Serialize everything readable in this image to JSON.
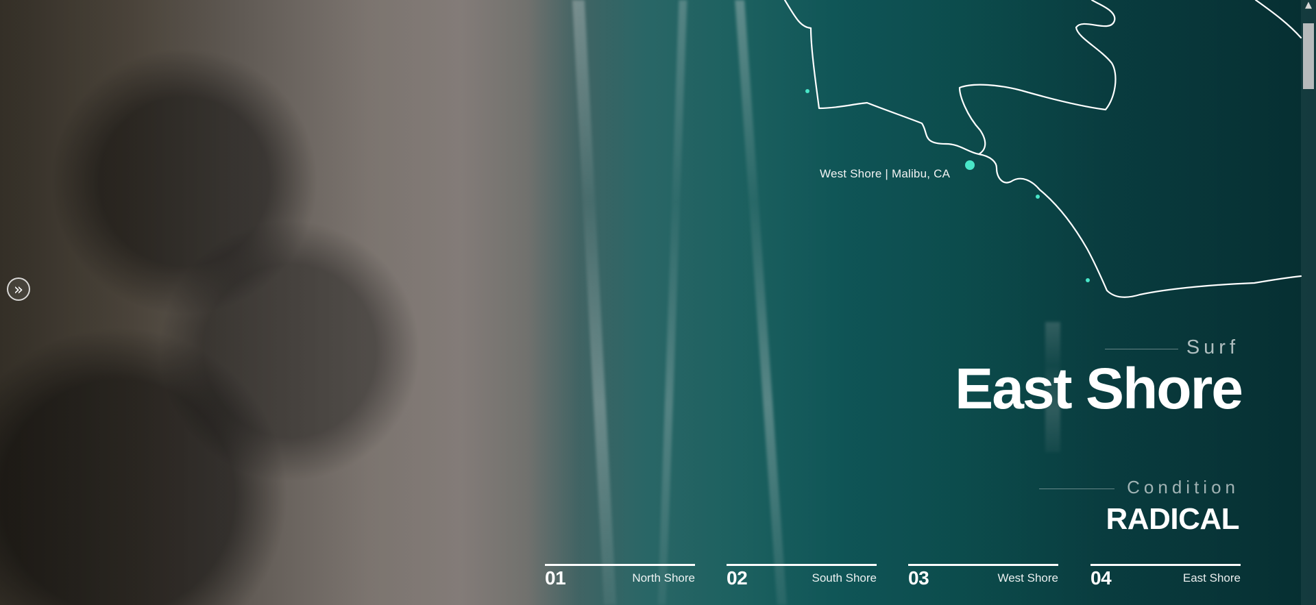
{
  "hero": {
    "location": "West Shore | Malibu, CA",
    "section_label": "Surf",
    "title": "East Shore",
    "condition_label": "Condition",
    "condition_value": "RADICAL"
  },
  "navigation": {
    "side_arrow": "»",
    "tabs": [
      {
        "number": "01",
        "label": "North Shore"
      },
      {
        "number": "02",
        "label": "South Shore"
      },
      {
        "number": "03",
        "label": "West Shore"
      },
      {
        "number": "04",
        "label": "East Shore"
      }
    ]
  },
  "scrollbar": {
    "up_arrow": "▲"
  },
  "colors": {
    "accent": "#49e6c8",
    "text": "#ffffff",
    "sea": "#0b4d50"
  }
}
